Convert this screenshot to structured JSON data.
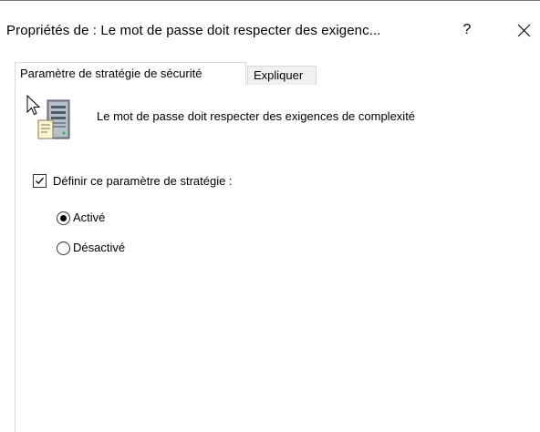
{
  "window": {
    "title": "Propriétés de : Le mot de passe doit respecter des exigenc...",
    "help_label": "?",
    "close_icon": "close-icon"
  },
  "tabs": [
    {
      "label": "Paramètre de stratégie de sécurité",
      "active": true
    },
    {
      "label": "Expliquer",
      "active": false
    }
  ],
  "policy": {
    "icon": "policy-server-icon",
    "title": "Le mot de passe doit respecter des exigences de complexité"
  },
  "define_setting": {
    "label": "Définir ce paramètre de stratégie :",
    "checked": true
  },
  "options": [
    {
      "label": "Activé",
      "selected": true
    },
    {
      "label": "Désactivé",
      "selected": false
    }
  ],
  "colors": {
    "border": "#d9d9d9",
    "inactive_tab_bg": "#f0f0f0",
    "text": "#000000"
  }
}
